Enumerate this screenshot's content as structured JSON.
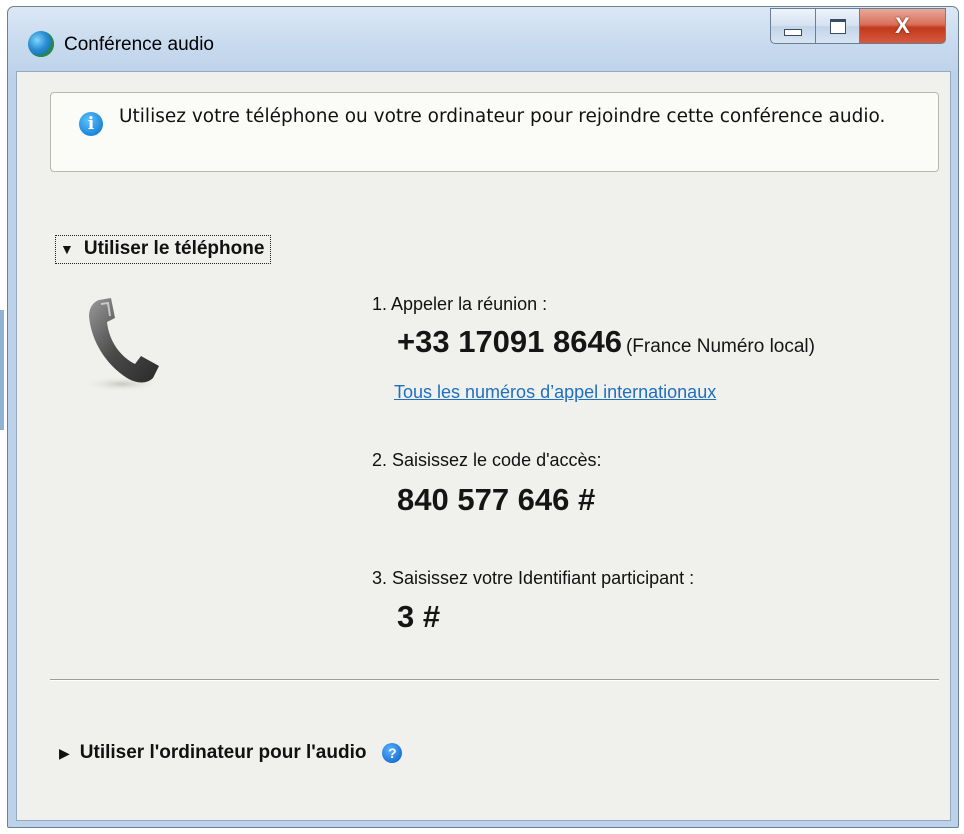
{
  "window": {
    "title": "Conférence audio",
    "controls": {
      "minimize_icon": "minimize-icon",
      "maximize_icon": "maximize-icon",
      "close_glyph": "X"
    }
  },
  "info": {
    "icon": "info-icon",
    "icon_glyph": "i",
    "text": "Utilisez votre téléphone ou votre ordinateur pour rejoindre cette conférence audio."
  },
  "phone_section": {
    "label": "Utiliser le téléphone",
    "expanded": true,
    "arrow": "▼",
    "icon": "phone-handset-icon",
    "steps": {
      "call": {
        "label": "1. Appeler la réunion :",
        "number": "+33 17091 8646",
        "number_note": "(France Numéro local)",
        "link": "Tous les numéros d’appel internationaux"
      },
      "access": {
        "label": "2. Saisissez le code d'accès:",
        "code": "840 577 646 #"
      },
      "participant": {
        "label": "3. Saisissez votre Identifiant participant :",
        "id": "3 #"
      }
    }
  },
  "computer_section": {
    "label": "Utiliser l'ordinateur pour l'audio",
    "expanded": false,
    "arrow": "▶",
    "help_icon": "help-icon",
    "help_glyph": "?"
  },
  "colors": {
    "link": "#1f6fbf",
    "accent_blue": "#1e86d8",
    "close_red": "#c2391c"
  }
}
